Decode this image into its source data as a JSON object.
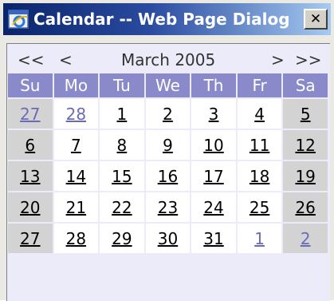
{
  "window": {
    "title": "Calendar -- Web Page Dialog",
    "close_glyph": "✕"
  },
  "nav": {
    "prev_year": "<<",
    "prev_month": "<",
    "month_label": "March 2005",
    "next_month": ">",
    "next_year": ">>"
  },
  "calendar": {
    "weekdays": [
      "Su",
      "Mo",
      "Tu",
      "We",
      "Th",
      "Fr",
      "Sa"
    ],
    "weeks": [
      [
        {
          "day": "27",
          "other": true
        },
        {
          "day": "28",
          "other": true
        },
        {
          "day": "1"
        },
        {
          "day": "2"
        },
        {
          "day": "3"
        },
        {
          "day": "4"
        },
        {
          "day": "5"
        }
      ],
      [
        {
          "day": "6"
        },
        {
          "day": "7"
        },
        {
          "day": "8"
        },
        {
          "day": "9"
        },
        {
          "day": "10"
        },
        {
          "day": "11"
        },
        {
          "day": "12"
        }
      ],
      [
        {
          "day": "13"
        },
        {
          "day": "14"
        },
        {
          "day": "15"
        },
        {
          "day": "16"
        },
        {
          "day": "17"
        },
        {
          "day": "18"
        },
        {
          "day": "19"
        }
      ],
      [
        {
          "day": "20"
        },
        {
          "day": "21"
        },
        {
          "day": "22"
        },
        {
          "day": "23"
        },
        {
          "day": "24"
        },
        {
          "day": "25"
        },
        {
          "day": "26"
        }
      ],
      [
        {
          "day": "27"
        },
        {
          "day": "28"
        },
        {
          "day": "29"
        },
        {
          "day": "30"
        },
        {
          "day": "31"
        },
        {
          "day": "1",
          "other": true
        },
        {
          "day": "2",
          "other": true
        }
      ]
    ]
  },
  "colors": {
    "header_bg": "#8a8acb",
    "weekend_bg": "#d3d3d3",
    "other_month_text": "#6a6ab8",
    "panel_bg": "#ebebfa"
  }
}
